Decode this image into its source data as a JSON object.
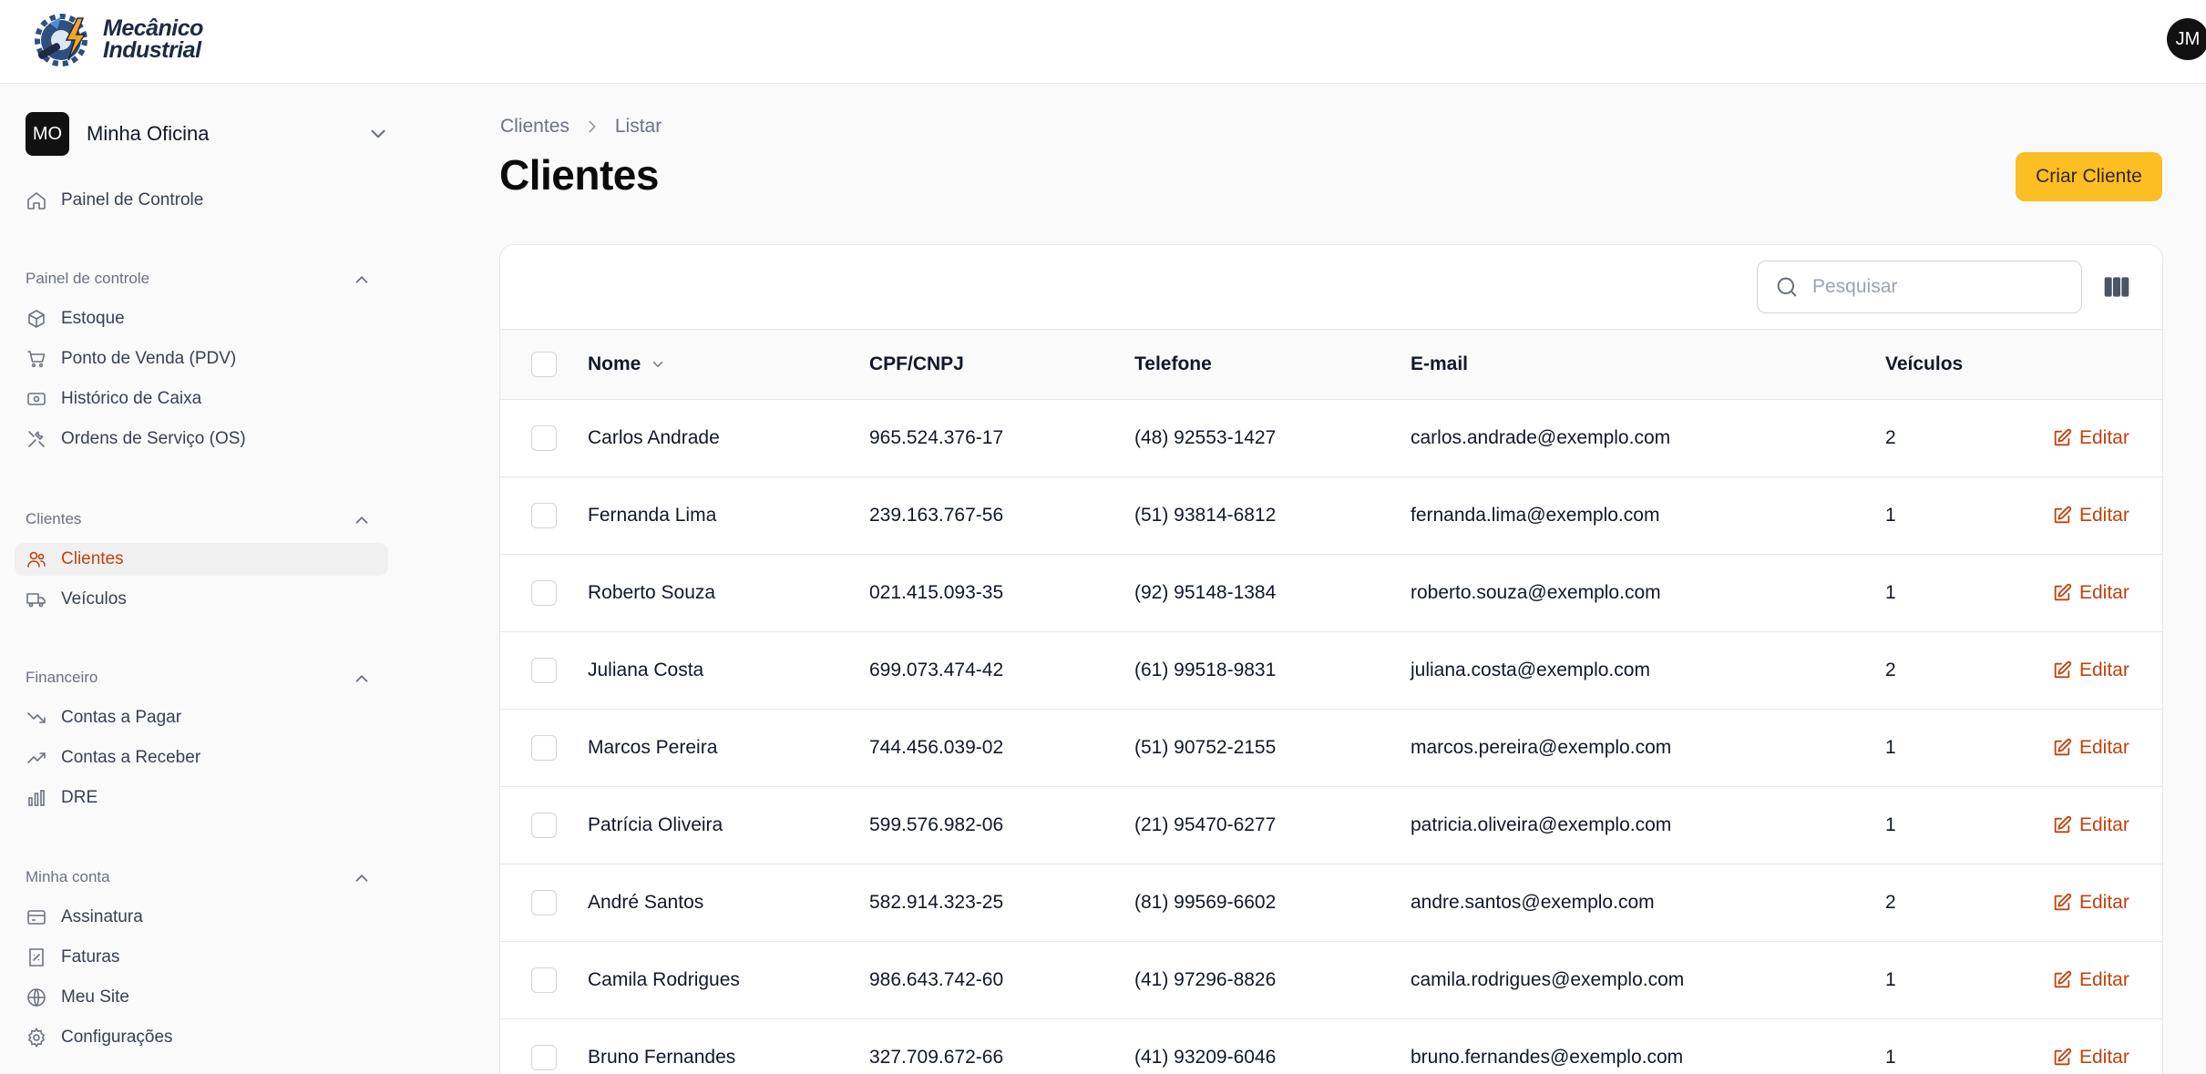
{
  "brand": {
    "line1": "Mecânico",
    "line2": "Industrial"
  },
  "user": {
    "initials": "JM"
  },
  "org": {
    "initials": "MO",
    "name": "Minha Oficina"
  },
  "nav": {
    "dashboard": "Painel de Controle",
    "groups": [
      {
        "label": "Painel de controle",
        "items": [
          "Estoque",
          "Ponto de Venda (PDV)",
          "Histórico de Caixa",
          "Ordens de Serviço (OS)"
        ]
      },
      {
        "label": "Clientes",
        "items": [
          "Clientes",
          "Veículos"
        ]
      },
      {
        "label": "Financeiro",
        "items": [
          "Contas a Pagar",
          "Contas a Receber",
          "DRE"
        ]
      },
      {
        "label": "Minha conta",
        "items": [
          "Assinatura",
          "Faturas",
          "Meu Site",
          "Configurações"
        ]
      }
    ],
    "active": "Clientes"
  },
  "breadcrumb": [
    "Clientes",
    "Listar"
  ],
  "page": {
    "title": "Clientes",
    "create_label": "Criar Cliente"
  },
  "search": {
    "placeholder": "Pesquisar",
    "value": ""
  },
  "table": {
    "columns": [
      "Nome",
      "CPF/CNPJ",
      "Telefone",
      "E-mail",
      "Veículos"
    ],
    "edit_label": "Editar",
    "rows": [
      [
        "Carlos Andrade",
        "965.524.376-17",
        "(48) 92553-1427",
        "carlos.andrade@exemplo.com",
        "2"
      ],
      [
        "Fernanda Lima",
        "239.163.767-56",
        "(51) 93814-6812",
        "fernanda.lima@exemplo.com",
        "1"
      ],
      [
        "Roberto Souza",
        "021.415.093-35",
        "(92) 95148-1384",
        "roberto.souza@exemplo.com",
        "1"
      ],
      [
        "Juliana Costa",
        "699.073.474-42",
        "(61) 99518-9831",
        "juliana.costa@exemplo.com",
        "2"
      ],
      [
        "Marcos Pereira",
        "744.456.039-02",
        "(51) 90752-2155",
        "marcos.pereira@exemplo.com",
        "1"
      ],
      [
        "Patrícia Oliveira",
        "599.576.982-06",
        "(21) 95470-6277",
        "patricia.oliveira@exemplo.com",
        "1"
      ],
      [
        "André Santos",
        "582.914.323-25",
        "(81) 99569-6602",
        "andre.santos@exemplo.com",
        "2"
      ],
      [
        "Camila Rodrigues",
        "986.643.742-60",
        "(41) 97296-8826",
        "camila.rodrigues@exemplo.com",
        "1"
      ],
      [
        "Bruno Fernandes",
        "327.709.672-66",
        "(41) 93209-6046",
        "bruno.fernandes@exemplo.com",
        "1"
      ]
    ]
  },
  "colors": {
    "accent": "#c2410c",
    "primary_button": "#fbbf24"
  }
}
